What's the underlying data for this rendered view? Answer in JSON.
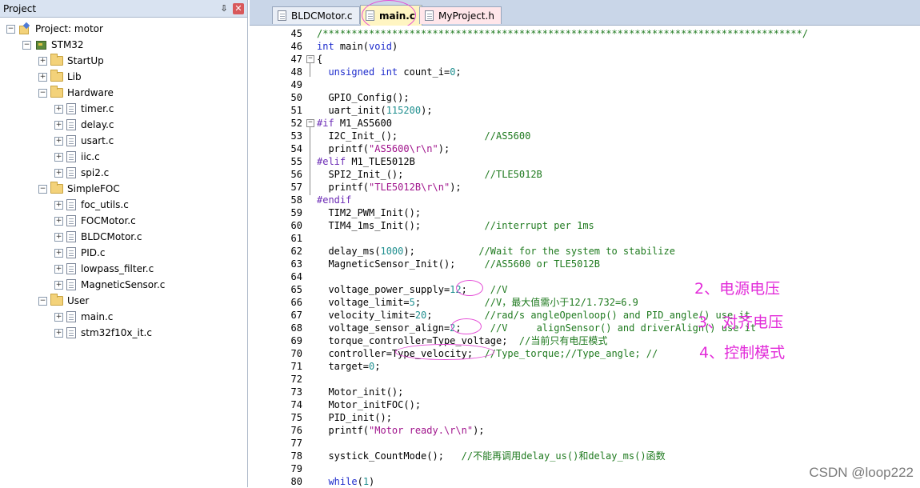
{
  "project_panel": {
    "title": "Project",
    "pin_glyph": "⇩",
    "close_glyph": "✕",
    "tree": [
      {
        "label": "Project: motor",
        "icon": "project-icon",
        "level": 0,
        "expanded": true
      },
      {
        "label": "STM32",
        "icon": "target-icon",
        "level": 1,
        "expanded": true
      },
      {
        "label": "StartUp",
        "icon": "folder-icon",
        "level": 2,
        "expanded": false
      },
      {
        "label": "Lib",
        "icon": "folder-icon",
        "level": 2,
        "expanded": false
      },
      {
        "label": "Hardware",
        "icon": "folder-icon",
        "level": 2,
        "expanded": true
      },
      {
        "label": "timer.c",
        "icon": "file-icon",
        "level": 3,
        "expanded": false
      },
      {
        "label": "delay.c",
        "icon": "file-icon",
        "level": 3,
        "expanded": false
      },
      {
        "label": "usart.c",
        "icon": "file-icon",
        "level": 3,
        "expanded": false
      },
      {
        "label": "iic.c",
        "icon": "file-icon",
        "level": 3,
        "expanded": false
      },
      {
        "label": "spi2.c",
        "icon": "file-icon",
        "level": 3,
        "expanded": false
      },
      {
        "label": "SimpleFOC",
        "icon": "folder-icon",
        "level": 2,
        "expanded": true
      },
      {
        "label": "foc_utils.c",
        "icon": "file-icon",
        "level": 3,
        "expanded": false
      },
      {
        "label": "FOCMotor.c",
        "icon": "file-icon",
        "level": 3,
        "expanded": false
      },
      {
        "label": "BLDCMotor.c",
        "icon": "file-icon",
        "level": 3,
        "expanded": false
      },
      {
        "label": "PID.c",
        "icon": "file-icon",
        "level": 3,
        "expanded": false
      },
      {
        "label": "lowpass_filter.c",
        "icon": "file-icon",
        "level": 3,
        "expanded": false
      },
      {
        "label": "MagneticSensor.c",
        "icon": "file-icon",
        "level": 3,
        "expanded": false
      },
      {
        "label": "User",
        "icon": "folder-icon",
        "level": 2,
        "expanded": true
      },
      {
        "label": "main.c",
        "icon": "file-icon",
        "level": 3,
        "expanded": false
      },
      {
        "label": "stm32f10x_it.c",
        "icon": "file-icon",
        "level": 3,
        "expanded": false
      }
    ]
  },
  "tabs": [
    {
      "label": "BLDCMotor.c",
      "active": false,
      "style": "normal"
    },
    {
      "label": "main.c",
      "active": true,
      "style": "normal"
    },
    {
      "label": "MyProject.h",
      "active": false,
      "style": "red"
    }
  ],
  "code_lines": [
    {
      "n": "45",
      "fold": "",
      "tokens": [
        [
          "cm",
          "/***********************************************************************************/"
        ]
      ]
    },
    {
      "n": "46",
      "fold": "",
      "tokens": [
        [
          "kw",
          "int"
        ],
        [
          "fn",
          " main("
        ],
        [
          "kw",
          "void"
        ],
        [
          "fn",
          ")"
        ]
      ]
    },
    {
      "n": "47",
      "fold": "−",
      "tokens": [
        [
          "fn",
          "{"
        ]
      ]
    },
    {
      "n": "48",
      "fold": "",
      "tokens": [
        [
          "fn",
          "  "
        ],
        [
          "kw",
          "unsigned int"
        ],
        [
          "fn",
          " count_i="
        ],
        [
          "num",
          "0"
        ],
        [
          "fn",
          ";"
        ]
      ]
    },
    {
      "n": "49",
      "fold": "",
      "tokens": []
    },
    {
      "n": "50",
      "fold": "",
      "tokens": [
        [
          "fn",
          "  GPIO_Config();"
        ]
      ]
    },
    {
      "n": "51",
      "fold": "",
      "tokens": [
        [
          "fn",
          "  uart_init("
        ],
        [
          "num",
          "115200"
        ],
        [
          "fn",
          ");"
        ]
      ]
    },
    {
      "n": "52",
      "fold": "−",
      "tokens": [
        [
          "pp",
          "#if"
        ],
        [
          "fn",
          " M1_AS5600"
        ]
      ]
    },
    {
      "n": "53",
      "fold": "",
      "tokens": [
        [
          "fn",
          "  I2C_Init_();               "
        ],
        [
          "cm",
          "//AS5600"
        ]
      ]
    },
    {
      "n": "54",
      "fold": "",
      "tokens": [
        [
          "fn",
          "  printf("
        ],
        [
          "str",
          "\"AS5600\\r\\n\""
        ],
        [
          "fn",
          ");"
        ]
      ]
    },
    {
      "n": "55",
      "fold": "",
      "tokens": [
        [
          "pp",
          "#elif"
        ],
        [
          "fn",
          " M1_TLE5012B"
        ]
      ]
    },
    {
      "n": "56",
      "fold": "",
      "tokens": [
        [
          "fn",
          "  SPI2_Init_();              "
        ],
        [
          "cm",
          "//TLE5012B"
        ]
      ]
    },
    {
      "n": "57",
      "fold": "",
      "tokens": [
        [
          "fn",
          "  printf("
        ],
        [
          "str",
          "\"TLE5012B\\r\\n\""
        ],
        [
          "fn",
          ");"
        ]
      ]
    },
    {
      "n": "58",
      "fold": "",
      "tokens": [
        [
          "pp",
          "#endif"
        ]
      ]
    },
    {
      "n": "59",
      "fold": "",
      "tokens": [
        [
          "fn",
          "  TIM2_PWM_Init();"
        ]
      ]
    },
    {
      "n": "60",
      "fold": "",
      "tokens": [
        [
          "fn",
          "  TIM4_1ms_Init();           "
        ],
        [
          "cm",
          "//interrupt per 1ms"
        ]
      ]
    },
    {
      "n": "61",
      "fold": "",
      "tokens": []
    },
    {
      "n": "62",
      "fold": "",
      "tokens": [
        [
          "fn",
          "  delay_ms("
        ],
        [
          "num",
          "1000"
        ],
        [
          "fn",
          ");           "
        ],
        [
          "cm",
          "//Wait for the system to stabilize"
        ]
      ]
    },
    {
      "n": "63",
      "fold": "",
      "tokens": [
        [
          "fn",
          "  MagneticSensor_Init();     "
        ],
        [
          "cm",
          "//AS5600 or TLE5012B"
        ]
      ]
    },
    {
      "n": "64",
      "fold": "",
      "tokens": []
    },
    {
      "n": "65",
      "fold": "",
      "tokens": [
        [
          "fn",
          "  voltage_power_supply="
        ],
        [
          "num",
          "12"
        ],
        [
          "fn",
          ";    "
        ],
        [
          "cm",
          "//V"
        ]
      ]
    },
    {
      "n": "66",
      "fold": "",
      "tokens": [
        [
          "fn",
          "  voltage_limit="
        ],
        [
          "num",
          "5"
        ],
        [
          "fn",
          ";           "
        ],
        [
          "cm",
          "//V，最大值需小于12/1.732=6.9"
        ]
      ]
    },
    {
      "n": "67",
      "fold": "",
      "tokens": [
        [
          "fn",
          "  velocity_limit="
        ],
        [
          "num",
          "20"
        ],
        [
          "fn",
          ";         "
        ],
        [
          "cm",
          "//rad/s angleOpenloop() and PID_angle() use it"
        ]
      ]
    },
    {
      "n": "68",
      "fold": "",
      "tokens": [
        [
          "fn",
          "  voltage_sensor_align="
        ],
        [
          "num",
          "2"
        ],
        [
          "fn",
          ";     "
        ],
        [
          "cm",
          "//V     alignSensor() and driverAlign() use it"
        ]
      ]
    },
    {
      "n": "69",
      "fold": "",
      "tokens": [
        [
          "fn",
          "  torque_controller=Type_voltage;  "
        ],
        [
          "cm",
          "//当前只有电压模式"
        ]
      ]
    },
    {
      "n": "70",
      "fold": "",
      "tokens": [
        [
          "fn",
          "  controller=Type_velocity;  "
        ],
        [
          "cm",
          "//Type_torque;//Type_angle; //"
        ]
      ]
    },
    {
      "n": "71",
      "fold": "",
      "tokens": [
        [
          "fn",
          "  target="
        ],
        [
          "num",
          "0"
        ],
        [
          "fn",
          ";"
        ]
      ]
    },
    {
      "n": "72",
      "fold": "",
      "tokens": []
    },
    {
      "n": "73",
      "fold": "",
      "tokens": [
        [
          "fn",
          "  Motor_init();"
        ]
      ]
    },
    {
      "n": "74",
      "fold": "",
      "tokens": [
        [
          "fn",
          "  Motor_initFOC();"
        ]
      ]
    },
    {
      "n": "75",
      "fold": "",
      "tokens": [
        [
          "fn",
          "  PID_init();"
        ]
      ]
    },
    {
      "n": "76",
      "fold": "",
      "tokens": [
        [
          "fn",
          "  printf("
        ],
        [
          "str",
          "\"Motor ready.\\r\\n\""
        ],
        [
          "fn",
          ");"
        ]
      ]
    },
    {
      "n": "77",
      "fold": "",
      "tokens": []
    },
    {
      "n": "78",
      "fold": "",
      "tokens": [
        [
          "fn",
          "  systick_CountMode();   "
        ],
        [
          "cm",
          "//不能再调用delay_us()和delay_ms()函数"
        ]
      ]
    },
    {
      "n": "79",
      "fold": "",
      "tokens": []
    },
    {
      "n": "80",
      "fold": "",
      "tokens": [
        [
          "fn",
          "  "
        ],
        [
          "kw",
          "while"
        ],
        [
          "fn",
          "("
        ],
        [
          "num",
          "1"
        ],
        [
          "fn",
          ")"
        ]
      ]
    }
  ],
  "annotations": {
    "a2": "2、电源电压",
    "a3": "3、对齐电压",
    "a4": "4、控制模式"
  },
  "watermark": "CSDN @loop222",
  "colors": {
    "annotation": "#e22bd9",
    "keyword": "#1d2bcc",
    "number": "#1f8f8f",
    "string": "#a0148c",
    "comment": "#1f7a1f",
    "preprocessor": "#6b2bb5"
  }
}
